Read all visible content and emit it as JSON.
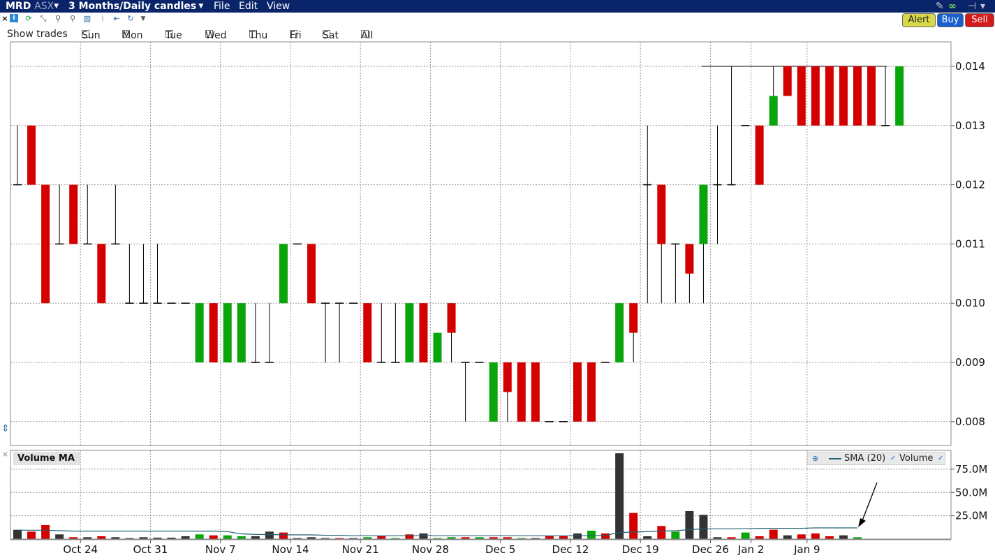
{
  "titlebar": {
    "ticker": "MRD",
    "exchange": "ASX",
    "period": "3 Months/Daily candles",
    "menus": [
      "File",
      "Edit",
      "View"
    ]
  },
  "buttons": {
    "alert": "Alert",
    "buy": "Buy",
    "sell": "Sell"
  },
  "show_trades": {
    "label": "Show trades",
    "days": [
      {
        "label": "Sun",
        "checked": false
      },
      {
        "label": "Mon",
        "checked": true
      },
      {
        "label": "Tue",
        "checked": false
      },
      {
        "label": "Wed",
        "checked": false
      },
      {
        "label": "Thu",
        "checked": false
      },
      {
        "label": "Fri",
        "checked": false
      },
      {
        "label": "Sat",
        "checked": false
      },
      {
        "label": "All",
        "checked": false
      }
    ]
  },
  "colors": {
    "up": "#0aa50a",
    "down": "#d40000",
    "volume_neutral": "#333333",
    "sma": "#206070",
    "titlebar": "#0a246a"
  },
  "icons": [
    "close-icon",
    "info-icon",
    "refresh-icon",
    "crosshair-icon",
    "zoom-in-icon",
    "zoom-out-icon",
    "draw-tool-icon",
    "cursor-icon",
    "zoom-fit-icon",
    "reload-icon",
    "dropdown-icon",
    "wrench-icon",
    "link-icon",
    "pin-icon"
  ],
  "volume_panel": {
    "title": "Volume MA",
    "legend": {
      "sma": "SMA (20)",
      "volume": "Volume"
    },
    "yticks": [
      "75.0M",
      "50.0M",
      "25.0M"
    ]
  },
  "chart_data": [
    {
      "type": "candlestick",
      "title": "",
      "ylim": [
        0.0075,
        0.0145
      ],
      "yticks": [
        "0.014",
        "0.013",
        "0.012",
        "0.011",
        "0.010",
        "0.009",
        "0.008"
      ],
      "xticks": [
        "Oct 24",
        "Oct 31",
        "Nov 7",
        "Nov 14",
        "Nov 21",
        "Nov 28",
        "Dec 5",
        "Dec 12",
        "Dec 19",
        "Dec 26",
        "Jan 2",
        "Jan 9"
      ],
      "grid": true,
      "candles": [
        {
          "o": 0.012,
          "h": 0.013,
          "l": 0.012,
          "c": 0.012
        },
        {
          "o": 0.013,
          "h": 0.013,
          "l": 0.012,
          "c": 0.012
        },
        {
          "o": 0.012,
          "h": 0.012,
          "l": 0.01,
          "c": 0.01
        },
        {
          "o": 0.011,
          "h": 0.012,
          "l": 0.011,
          "c": 0.011
        },
        {
          "o": 0.012,
          "h": 0.012,
          "l": 0.011,
          "c": 0.011
        },
        {
          "o": 0.011,
          "h": 0.012,
          "l": 0.011,
          "c": 0.011
        },
        {
          "o": 0.011,
          "h": 0.011,
          "l": 0.01,
          "c": 0.01
        },
        {
          "o": 0.011,
          "h": 0.012,
          "l": 0.011,
          "c": 0.011
        },
        {
          "o": 0.01,
          "h": 0.011,
          "l": 0.01,
          "c": 0.01
        },
        {
          "o": 0.01,
          "h": 0.011,
          "l": 0.01,
          "c": 0.01
        },
        {
          "o": 0.01,
          "h": 0.011,
          "l": 0.01,
          "c": 0.01
        },
        {
          "o": 0.01,
          "h": 0.01,
          "l": 0.01,
          "c": 0.01
        },
        {
          "o": 0.01,
          "h": 0.01,
          "l": 0.01,
          "c": 0.01
        },
        {
          "o": 0.009,
          "h": 0.01,
          "l": 0.009,
          "c": 0.01
        },
        {
          "o": 0.01,
          "h": 0.01,
          "l": 0.009,
          "c": 0.009
        },
        {
          "o": 0.009,
          "h": 0.01,
          "l": 0.009,
          "c": 0.01
        },
        {
          "o": 0.009,
          "h": 0.01,
          "l": 0.009,
          "c": 0.01
        },
        {
          "o": 0.009,
          "h": 0.01,
          "l": 0.009,
          "c": 0.009
        },
        {
          "o": 0.009,
          "h": 0.01,
          "l": 0.009,
          "c": 0.009
        },
        {
          "o": 0.01,
          "h": 0.011,
          "l": 0.01,
          "c": 0.011
        },
        {
          "o": 0.011,
          "h": 0.011,
          "l": 0.011,
          "c": 0.011
        },
        {
          "o": 0.011,
          "h": 0.011,
          "l": 0.01,
          "c": 0.01
        },
        {
          "o": 0.01,
          "h": 0.01,
          "l": 0.009,
          "c": 0.01
        },
        {
          "o": 0.01,
          "h": 0.01,
          "l": 0.009,
          "c": 0.01
        },
        {
          "o": 0.01,
          "h": 0.01,
          "l": 0.01,
          "c": 0.01
        },
        {
          "o": 0.01,
          "h": 0.01,
          "l": 0.009,
          "c": 0.009
        },
        {
          "o": 0.009,
          "h": 0.01,
          "l": 0.009,
          "c": 0.009
        },
        {
          "o": 0.009,
          "h": 0.01,
          "l": 0.009,
          "c": 0.009
        },
        {
          "o": 0.009,
          "h": 0.01,
          "l": 0.009,
          "c": 0.01
        },
        {
          "o": 0.01,
          "h": 0.01,
          "l": 0.009,
          "c": 0.009
        },
        {
          "o": 0.009,
          "h": 0.0095,
          "l": 0.009,
          "c": 0.0095
        },
        {
          "o": 0.01,
          "h": 0.01,
          "l": 0.009,
          "c": 0.0095
        },
        {
          "o": 0.009,
          "h": 0.009,
          "l": 0.008,
          "c": 0.009
        },
        {
          "o": 0.009,
          "h": 0.009,
          "l": 0.009,
          "c": 0.009
        },
        {
          "o": 0.008,
          "h": 0.009,
          "l": 0.008,
          "c": 0.009
        },
        {
          "o": 0.009,
          "h": 0.009,
          "l": 0.008,
          "c": 0.0085
        },
        {
          "o": 0.009,
          "h": 0.009,
          "l": 0.008,
          "c": 0.008
        },
        {
          "o": 0.009,
          "h": 0.009,
          "l": 0.008,
          "c": 0.008
        },
        {
          "o": 0.008,
          "h": 0.008,
          "l": 0.008,
          "c": 0.008
        },
        {
          "o": 0.008,
          "h": 0.008,
          "l": 0.008,
          "c": 0.008
        },
        {
          "o": 0.009,
          "h": 0.009,
          "l": 0.008,
          "c": 0.008
        },
        {
          "o": 0.009,
          "h": 0.009,
          "l": 0.008,
          "c": 0.008
        },
        {
          "o": 0.009,
          "h": 0.009,
          "l": 0.009,
          "c": 0.009
        },
        {
          "o": 0.009,
          "h": 0.01,
          "l": 0.009,
          "c": 0.01
        },
        {
          "o": 0.01,
          "h": 0.01,
          "l": 0.009,
          "c": 0.0095
        },
        {
          "o": 0.012,
          "h": 0.013,
          "l": 0.01,
          "c": 0.012
        },
        {
          "o": 0.012,
          "h": 0.012,
          "l": 0.01,
          "c": 0.011
        },
        {
          "o": 0.011,
          "h": 0.011,
          "l": 0.01,
          "c": 0.011
        },
        {
          "o": 0.011,
          "h": 0.011,
          "l": 0.01,
          "c": 0.0105
        },
        {
          "o": 0.011,
          "h": 0.012,
          "l": 0.01,
          "c": 0.012
        },
        {
          "o": 0.012,
          "h": 0.013,
          "l": 0.011,
          "c": 0.012
        },
        {
          "o": 0.012,
          "h": 0.014,
          "l": 0.012,
          "c": 0.012
        },
        {
          "o": 0.013,
          "h": 0.013,
          "l": 0.013,
          "c": 0.013
        },
        {
          "o": 0.013,
          "h": 0.013,
          "l": 0.012,
          "c": 0.012
        },
        {
          "o": 0.013,
          "h": 0.014,
          "l": 0.013,
          "c": 0.0135
        },
        {
          "o": 0.014,
          "h": 0.014,
          "l": 0.0135,
          "c": 0.0135
        },
        {
          "o": 0.014,
          "h": 0.014,
          "l": 0.013,
          "c": 0.013
        },
        {
          "o": 0.014,
          "h": 0.014,
          "l": 0.013,
          "c": 0.013
        },
        {
          "o": 0.014,
          "h": 0.014,
          "l": 0.013,
          "c": 0.013
        },
        {
          "o": 0.014,
          "h": 0.014,
          "l": 0.013,
          "c": 0.013
        },
        {
          "o": 0.014,
          "h": 0.014,
          "l": 0.013,
          "c": 0.013
        },
        {
          "o": 0.014,
          "h": 0.014,
          "l": 0.013,
          "c": 0.013
        },
        {
          "o": 0.013,
          "h": 0.014,
          "l": 0.013,
          "c": 0.013
        },
        {
          "o": 0.013,
          "h": 0.014,
          "l": 0.013,
          "c": 0.014
        }
      ]
    },
    {
      "type": "bar",
      "title": "Volume MA",
      "ylim": [
        0,
        95
      ],
      "yunit": "M",
      "yticks": [
        "75.0M",
        "50.0M",
        "25.0M"
      ],
      "series": [
        {
          "name": "Volume",
          "values": [
            10,
            8,
            15,
            5,
            2,
            2,
            3,
            2,
            1,
            2,
            1.5,
            1.5,
            3,
            5,
            4,
            4,
            3,
            3,
            8,
            7,
            1,
            2,
            1,
            1,
            1,
            2,
            3,
            1,
            5,
            6,
            1,
            2,
            2,
            2,
            2,
            2,
            1,
            1,
            3,
            3,
            6,
            9,
            6,
            92,
            28,
            3,
            14,
            8,
            30,
            26,
            2,
            2,
            7,
            3,
            10,
            4,
            5,
            6,
            3,
            4,
            2
          ],
          "colors": [
            "n",
            "d",
            "d",
            "n",
            "d",
            "n",
            "d",
            "n",
            "n",
            "n",
            "n",
            "n",
            "n",
            "u",
            "d",
            "u",
            "u",
            "n",
            "n",
            "d",
            "n",
            "n",
            "n",
            "d",
            "n",
            "u",
            "d",
            "u",
            "d",
            "n",
            "u",
            "u",
            "d",
            "u",
            "d",
            "d",
            "u",
            "n",
            "d",
            "d",
            "n",
            "u",
            "d",
            "n",
            "d",
            "n",
            "d",
            "u",
            "n",
            "n",
            "n",
            "d",
            "u",
            "d",
            "d",
            "n",
            "d",
            "d",
            "d",
            "n",
            "u"
          ]
        },
        {
          "name": "SMA (20)",
          "values": [
            9.5,
            9.5,
            9.5,
            9,
            8.5,
            8.5,
            8.5,
            8.5,
            8.5,
            8.5,
            8.5,
            8.5,
            8.5,
            8.5,
            8.5,
            8,
            5.5,
            5,
            4.8,
            4.6,
            4.5,
            4.5,
            4,
            4,
            3.5,
            3.5,
            3.5,
            3.5,
            3.5,
            3.5,
            3.5,
            3.5,
            3.5,
            3.5,
            3.5,
            3.5,
            3.5,
            3.5,
            3.5,
            3.5,
            3.5,
            3.5,
            4,
            7,
            7.5,
            8,
            8.5,
            9,
            10,
            11,
            11,
            11,
            11,
            11.5,
            11.5,
            11.5,
            11.5,
            12,
            12,
            12,
            12
          ]
        }
      ]
    }
  ]
}
